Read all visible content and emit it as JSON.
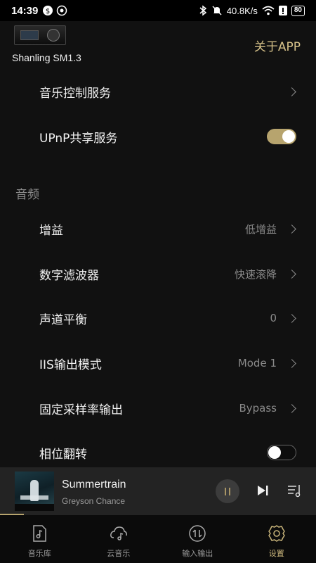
{
  "status_bar": {
    "time": "14:39",
    "network_speed": "40.8K/s",
    "battery": "80",
    "icons": [
      "app-icon-1",
      "app-icon-2",
      "bluetooth-icon",
      "mute-icon",
      "wifi-icon",
      "alert-icon",
      "battery-icon"
    ]
  },
  "header": {
    "device_name": "Shanling SM1.3",
    "about_label": "关于APP"
  },
  "settings": {
    "music_control": {
      "label": "音乐控制服务"
    },
    "upnp": {
      "label": "UPnP共享服务",
      "enabled": true
    },
    "section_audio": "音频",
    "gain": {
      "label": "增益",
      "value": "低增益"
    },
    "filter": {
      "label": "数字滤波器",
      "value": "快速滚降"
    },
    "balance": {
      "label": "声道平衡",
      "value": "0"
    },
    "iis": {
      "label": "IIS输出模式",
      "value": "Mode 1"
    },
    "sample_rate": {
      "label": "固定采样率输出",
      "value": "Bypass"
    },
    "phase": {
      "label": "相位翻转",
      "enabled": false
    }
  },
  "player": {
    "title": "Summertrain",
    "artist": "Greyson Chance",
    "state": "playing"
  },
  "tabs": [
    {
      "label": "音乐库",
      "icon": "music-file-icon"
    },
    {
      "label": "云音乐",
      "icon": "cloud-music-icon"
    },
    {
      "label": "输入输出",
      "icon": "io-arrows-icon"
    },
    {
      "label": "设置",
      "icon": "gear-icon"
    }
  ],
  "colors": {
    "accent": "#b7a46e",
    "background": "#111111",
    "player_bg": "#232323"
  }
}
